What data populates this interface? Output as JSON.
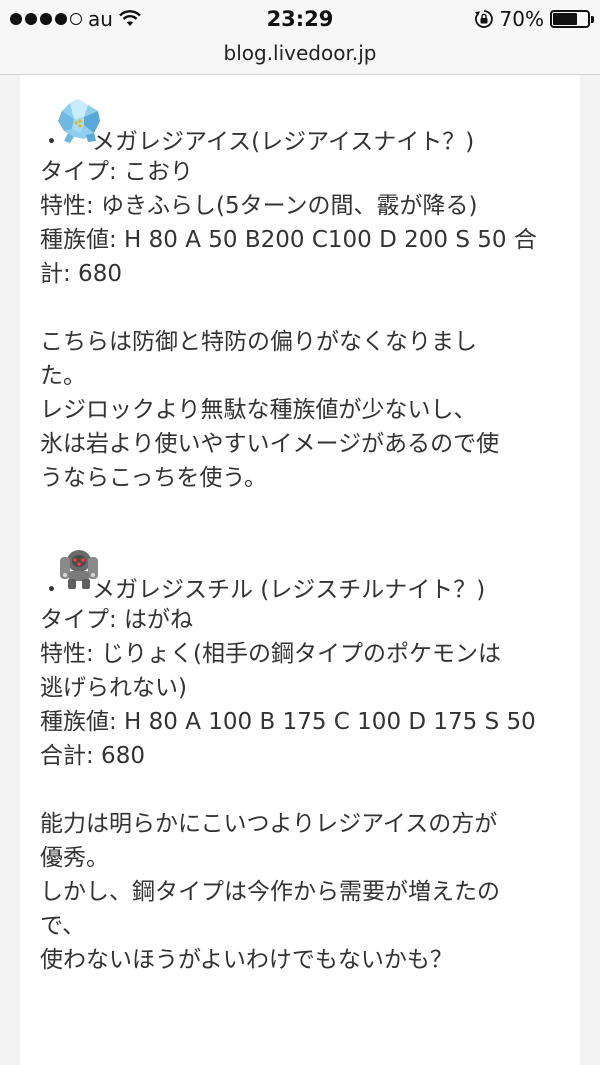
{
  "status": {
    "carrier": "au",
    "time": "23:29",
    "battery": "70%",
    "battery_fraction": 0.7
  },
  "url": "blog.livedoor.jp",
  "entries": [
    {
      "bullet": "・",
      "name": "メガレジアイス(レジアイスナイト？)",
      "type": "タイプ: こおり",
      "ability": "特性: ゆきふらし(5ターンの間、霰が降る)",
      "stats_1": "種族値: H 80 A 50 B200 C100 D 200 S 50 合",
      "stats_2": "計: 680",
      "comment": [
        "こちらは防御と特防の偏りがなくなりまし",
        "た。",
        "レジロックより無駄な種族値が少ないし、",
        "氷は岩より使いやすいイメージがあるので使",
        "うならこっちを使う。"
      ]
    },
    {
      "bullet": "・",
      "name": "メガレジスチル (レジスチルナイト？)",
      "type": "タイプ: はがね",
      "ability_1": "特性: じりょく(相手の鋼タイプのポケモンは",
      "ability_2": "逃げられない)",
      "stats_1": "種族値: H 80 A 100 B 175 C 100 D 175 S 50",
      "stats_2": "合計: 680",
      "comment": [
        "能力は明らかにこいつよりレジアイスの方が",
        "優秀。",
        "しかし、鋼タイプは今作から需要が増えたの",
        "で、",
        "使わないほうがよいわけでもないかも？"
      ]
    }
  ]
}
